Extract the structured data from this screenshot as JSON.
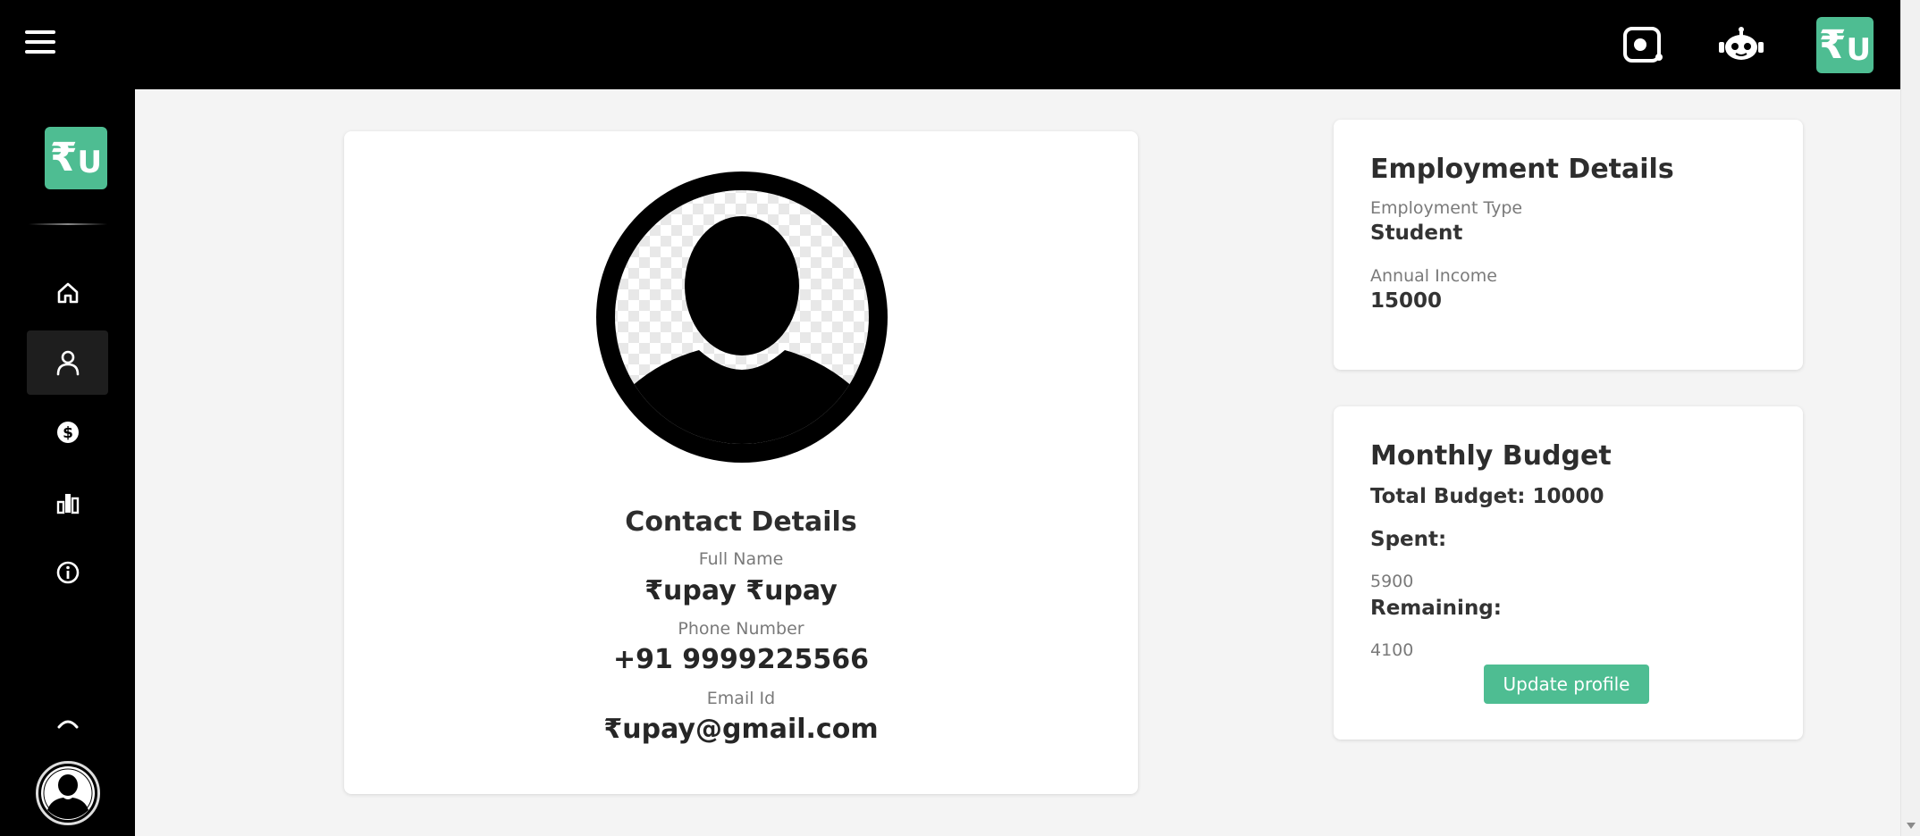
{
  "header": {
    "menu_icon": "hamburger-menu-icon",
    "icons": [
      "screen-record-icon",
      "chatbot-icon"
    ],
    "logo": {
      "symbol": "₹",
      "letter": "U"
    }
  },
  "sidebar": {
    "logo": {
      "symbol": "₹",
      "letter": "U"
    },
    "items": [
      {
        "name": "home",
        "icon": "home-icon"
      },
      {
        "name": "profile",
        "icon": "user-icon",
        "active": true
      },
      {
        "name": "transactions",
        "icon": "dollar-circle-icon"
      },
      {
        "name": "analytics",
        "icon": "bar-chart-icon"
      },
      {
        "name": "about",
        "icon": "info-icon"
      }
    ],
    "collapse_icon": "chevron-up-icon",
    "avatar_icon": "user-avatar-icon"
  },
  "contact": {
    "title": "Contact Details",
    "full_name_label": "Full Name",
    "full_name": "₹upay ₹upay",
    "phone_label": "Phone Number",
    "phone": "+91 9999225566",
    "email_label": "Email Id",
    "email": "₹upay@gmail.com"
  },
  "employment": {
    "title": "Employment Details",
    "type_label": "Employment Type",
    "type": "Student",
    "income_label": "Annual Income",
    "income": "15000"
  },
  "budget": {
    "title": "Monthly Budget",
    "total": "Total Budget: 10000",
    "spent_label": "Spent:",
    "spent": "5900",
    "remaining_label": "Remaining:",
    "remaining": "4100",
    "update_button": "Update profile"
  },
  "colors": {
    "accent": "#4ebd92",
    "topbar": "#000000",
    "background": "#f4f4f4"
  }
}
